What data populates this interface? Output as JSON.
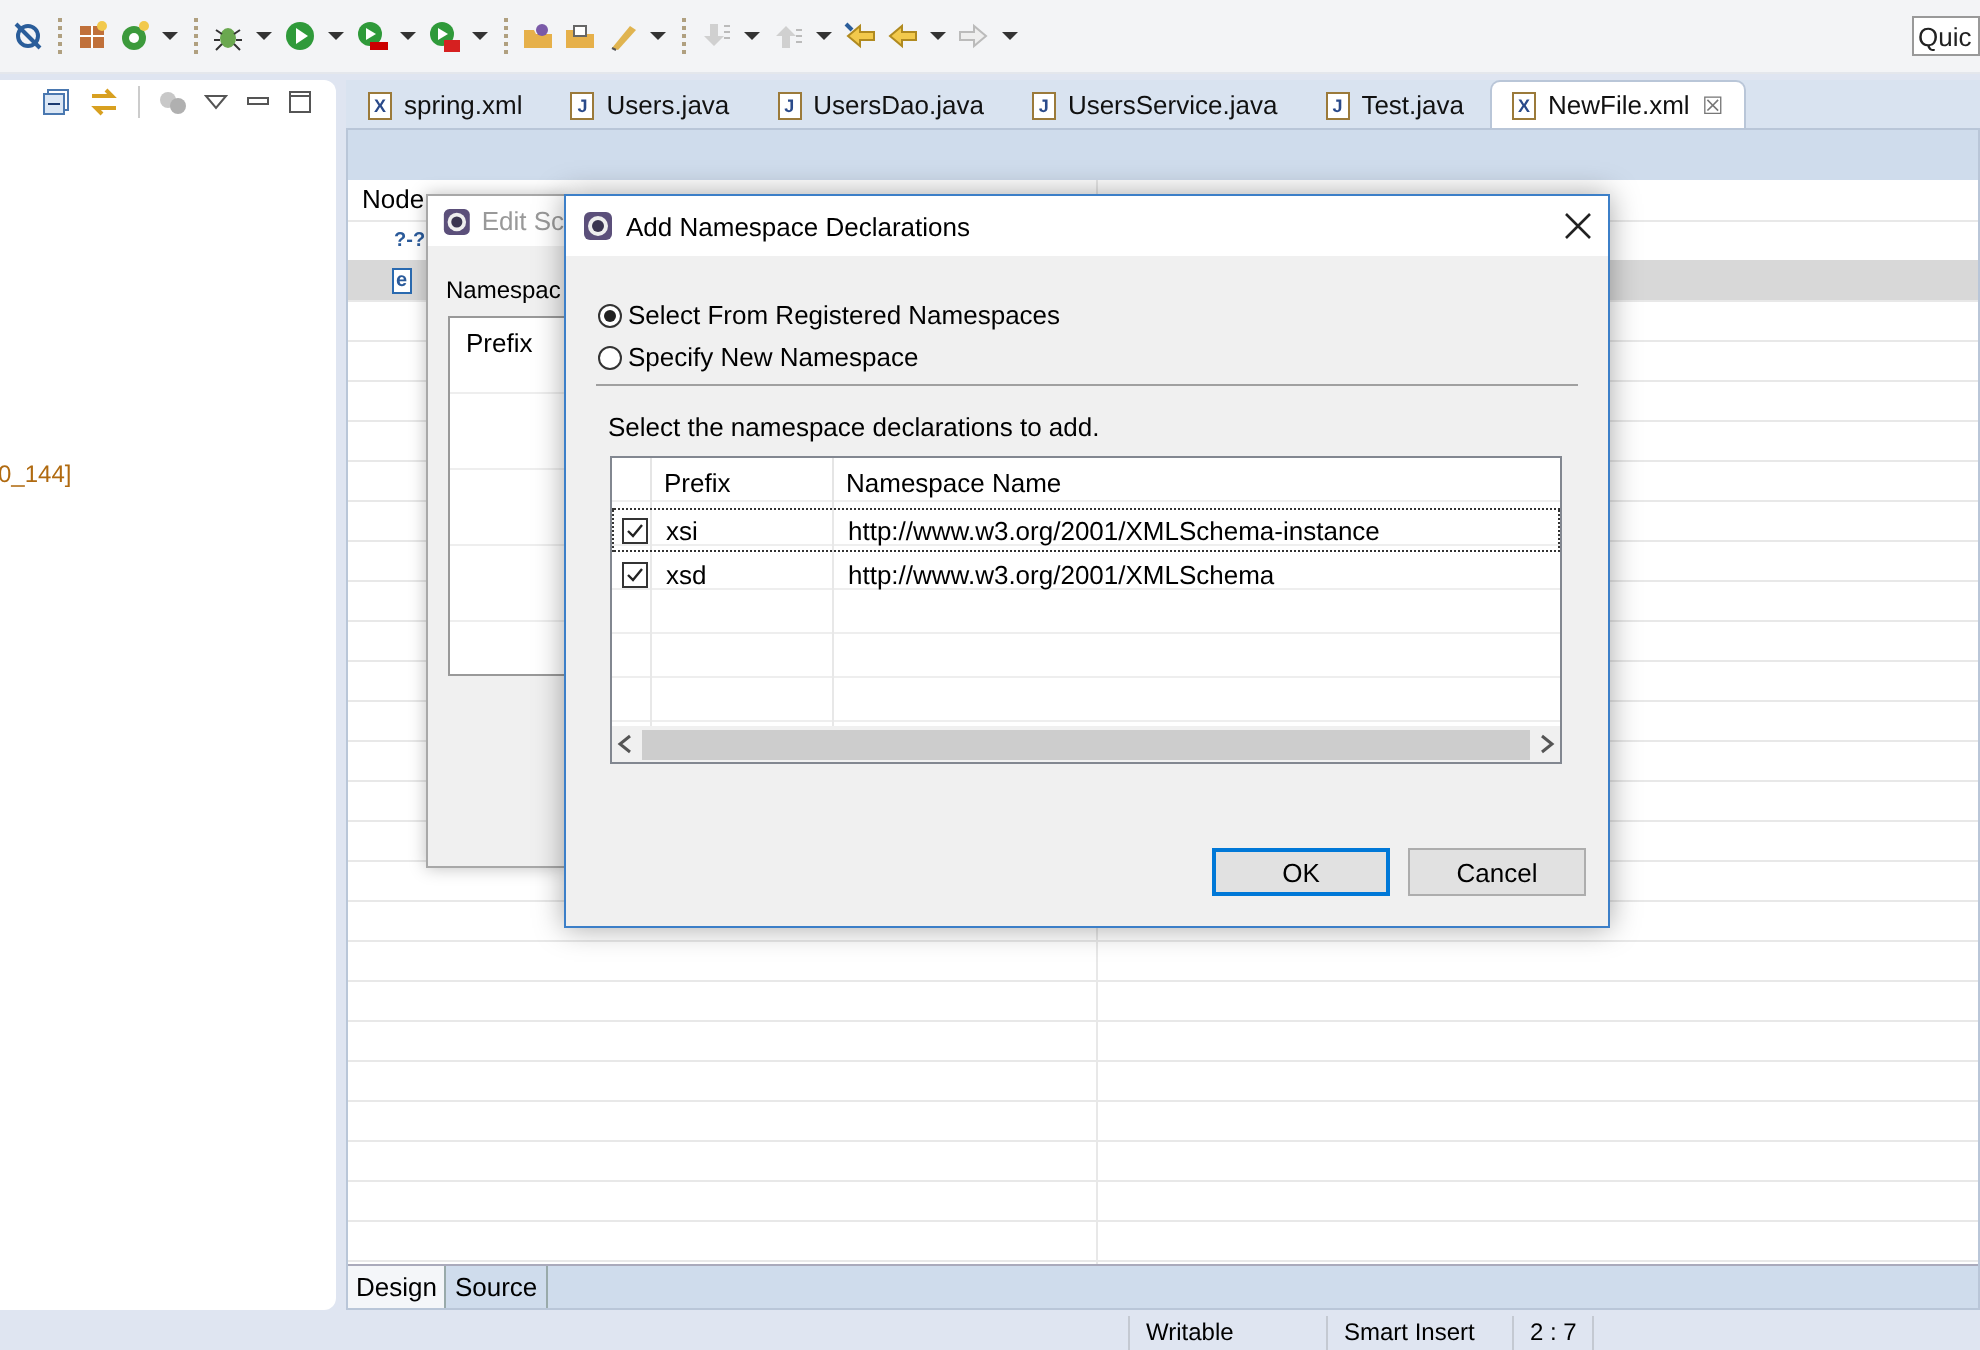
{
  "toolbar": {
    "quick_access": {
      "placeholder": "Quic"
    }
  },
  "left_panel": {
    "text": "0_144]"
  },
  "editor": {
    "tabs": [
      {
        "label": "spring.xml",
        "icon": "X",
        "selected": false
      },
      {
        "label": "Users.java",
        "icon": "J",
        "selected": false
      },
      {
        "label": "UsersDao.java",
        "icon": "J",
        "selected": false
      },
      {
        "label": "UsersService.java",
        "icon": "J",
        "selected": false
      },
      {
        "label": "Test.java",
        "icon": "J",
        "selected": false
      },
      {
        "label": "NewFile.xml",
        "icon": "X",
        "selected": true
      }
    ],
    "close_mark": "☒",
    "node_header": "Node",
    "nodes": [
      {
        "icon": "?-?",
        "selected": false
      },
      {
        "icon": "e",
        "selected": true
      }
    ],
    "bottom_tabs": [
      {
        "label": "Design",
        "selected": true
      },
      {
        "label": "Source",
        "selected": false
      }
    ]
  },
  "back_dialog": {
    "title": "Edit Sc",
    "label": "Namespac",
    "column": "Prefix"
  },
  "dialog": {
    "title": "Add Namespace Declarations",
    "options": [
      {
        "label": "Select From Registered Namespaces",
        "selected": true
      },
      {
        "label": "Specify New Namespace",
        "selected": false
      }
    ],
    "instruction": "Select the namespace declarations to add.",
    "columns": [
      "Prefix",
      "Namespace Name"
    ],
    "rows": [
      {
        "prefix": "xsi",
        "namespace": "http://www.w3.org/2001/XMLSchema-instance",
        "checked": true,
        "selected": true
      },
      {
        "prefix": "xsd",
        "namespace": "http://www.w3.org/2001/XMLSchema",
        "checked": true,
        "selected": false
      }
    ],
    "buttons": [
      {
        "label": "OK",
        "kind": "default"
      },
      {
        "label": "Cancel",
        "kind": "normal"
      }
    ]
  },
  "status_bar": {
    "items": [
      "Writable",
      "Smart Insert",
      "2 : 7"
    ]
  }
}
